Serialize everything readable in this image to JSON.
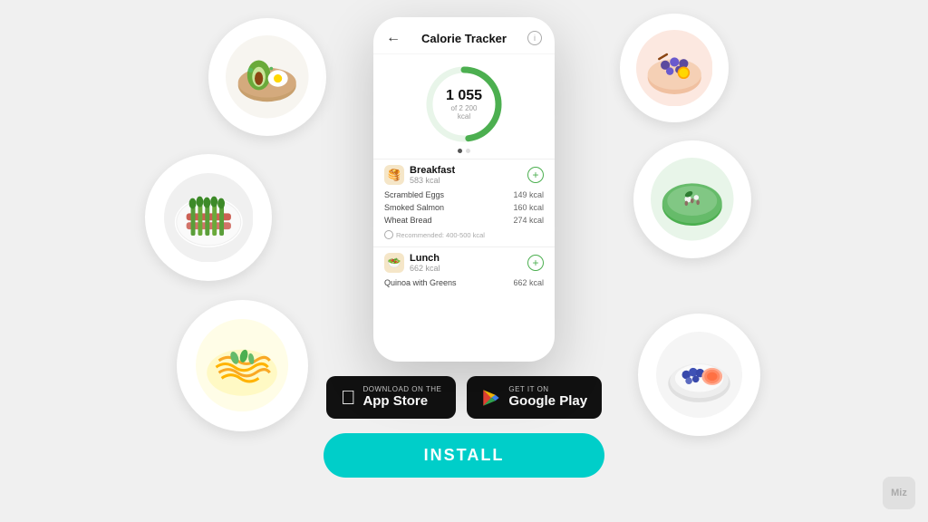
{
  "page": {
    "background_color": "#f0f0f0"
  },
  "phone": {
    "header": {
      "back_arrow": "←",
      "title": "Calorie Tracker",
      "info_icon": "i"
    },
    "calorie_ring": {
      "current": "1 055",
      "total_label": "of 2 200 kcal",
      "percentage": 47.9,
      "color": "#4CAF50",
      "track_color": "#E8F5E9"
    },
    "meals": [
      {
        "name": "Breakfast",
        "kcal": "583 kcal",
        "icon": "🥞",
        "items": [
          {
            "name": "Scrambled Eggs",
            "kcal": "149 kcal"
          },
          {
            "name": "Smoked Salmon",
            "kcal": "160 kcal"
          },
          {
            "name": "Wheat Bread",
            "kcal": "274 kcal"
          }
        ],
        "recommended": "Recommended: 400-500 kcal"
      },
      {
        "name": "Lunch",
        "kcal": "662 kcal",
        "icon": "🥗",
        "items": [
          {
            "name": "Quinoa with Greens",
            "kcal": "662 kcal"
          }
        ]
      }
    ]
  },
  "store_buttons": {
    "app_store": {
      "sub_label": "Download on the",
      "main_label": "App Store",
      "icon": "apple"
    },
    "google_play": {
      "sub_label": "GET IT ON",
      "main_label": "Google Play",
      "icon": "play"
    }
  },
  "install_button": {
    "label": "INSTALL",
    "color": "#00CEC9"
  },
  "watermark": {
    "text": "Miz"
  }
}
